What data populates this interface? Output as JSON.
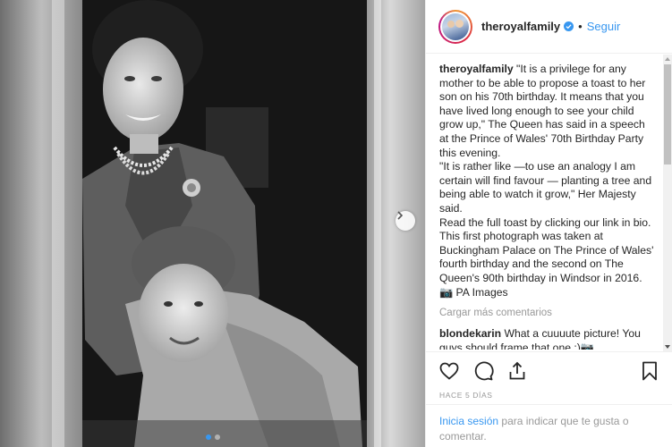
{
  "header": {
    "username": "theroyalfamily",
    "separator": "•",
    "follow_label": "Seguir"
  },
  "caption": {
    "username": "theroyalfamily",
    "text": "\"It is a privilege for any mother to be able to propose a toast to her son on his 70th birthday. It means that you have lived long enough to see your child grow up,\" The Queen has said in a speech at the Prince of Wales' 70th Birthday Party this evening.",
    "text2": "\"It is rather like —to use an analogy I am certain will find favour — planting a tree and being able to watch it grow,\" Her Majesty said.",
    "text3": "Read the full toast by clicking our link in bio. This first photograph was taken at Buckingham Palace on The Prince of Wales' fourth birthday and the second on The Queen's 90th birthday in Windsor in 2016.",
    "credit": "📷 PA Images"
  },
  "load_more": "Cargar más comentarios",
  "comments": [
    {
      "username": "blondekarin",
      "text": "What a cuuuute picture! You guys should frame that one :)📷"
    }
  ],
  "time_ago": "HACE 5 DÍAS",
  "login": {
    "link": "Inicia sesión",
    "rest": "para indicar que te gusta o comentar."
  },
  "carousel": {
    "slides": 2,
    "active": 0
  },
  "colors": {
    "accent": "#3897f0",
    "text": "#262626",
    "muted": "#999999"
  }
}
